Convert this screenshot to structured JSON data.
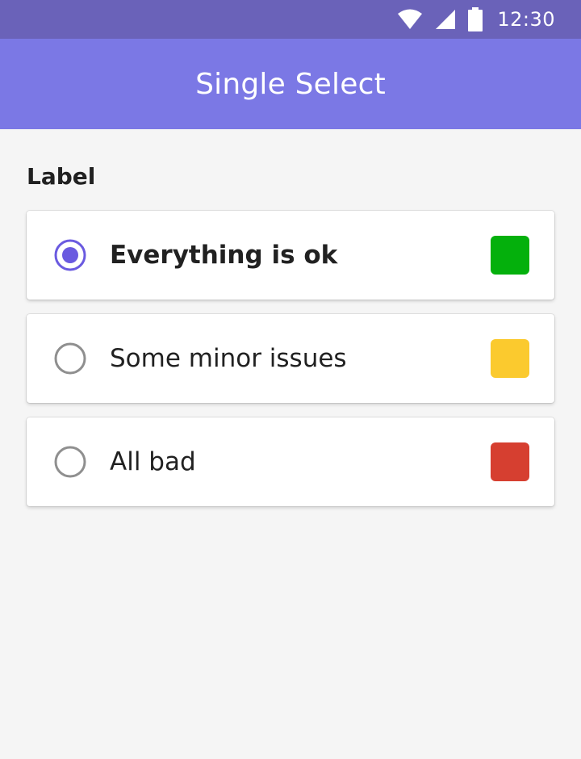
{
  "status_bar": {
    "time": "12:30",
    "icons": [
      "wifi-icon",
      "cell-signal-icon",
      "battery-icon"
    ]
  },
  "app_bar": {
    "title": "Single Select",
    "color": "#7b78e5"
  },
  "field": {
    "label": "Label"
  },
  "options": [
    {
      "label": "Everything is ok",
      "selected": true,
      "color": "#04b00c"
    },
    {
      "label": "Some minor issues",
      "selected": false,
      "color": "#fbca2e"
    },
    {
      "label": "All bad",
      "selected": false,
      "color": "#d63f30"
    }
  ],
  "accent_color": "#6a5ae0"
}
